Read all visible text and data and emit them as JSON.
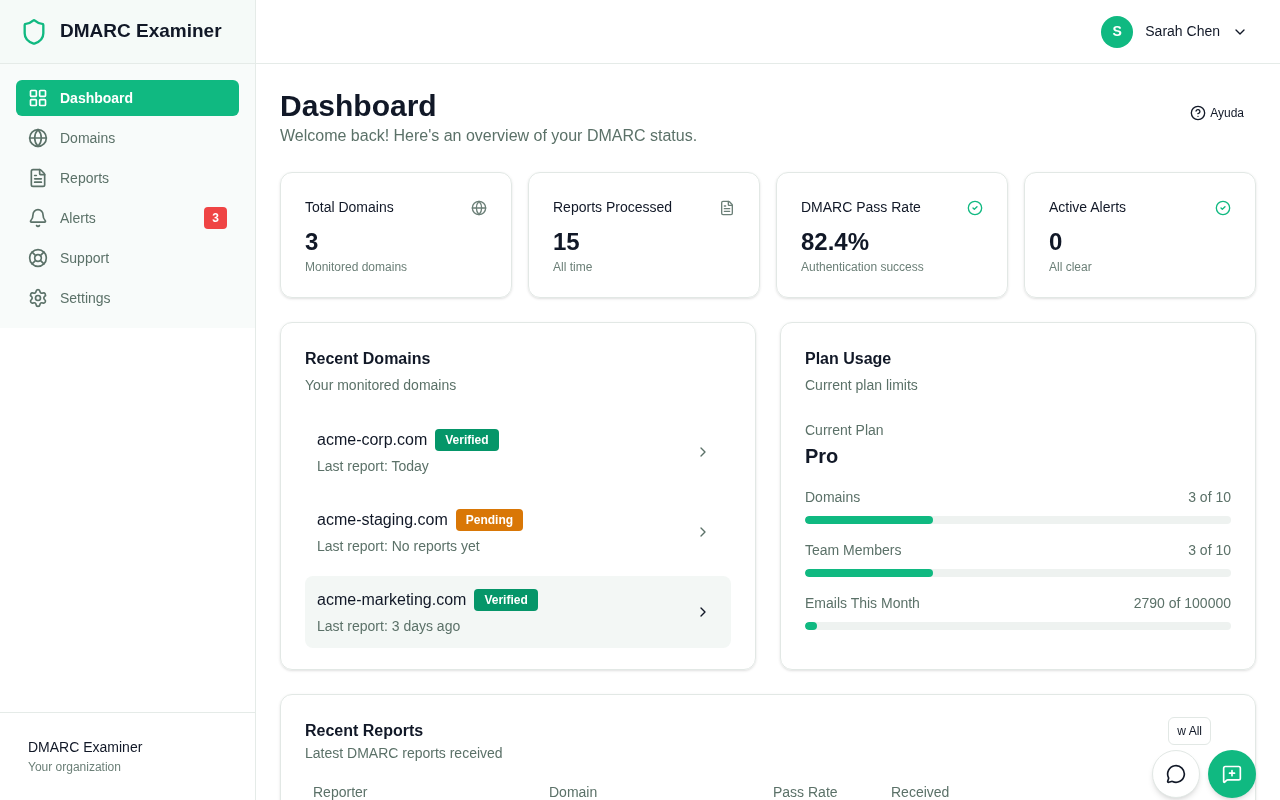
{
  "app": {
    "name": "DMARC Examiner"
  },
  "sidebar": {
    "items": [
      {
        "label": "Dashboard",
        "selected": true
      },
      {
        "label": "Domains",
        "selected": false
      },
      {
        "label": "Reports",
        "selected": false
      },
      {
        "label": "Alerts",
        "selected": false,
        "badge": "3"
      },
      {
        "label": "Support",
        "selected": false
      },
      {
        "label": "Settings",
        "selected": false
      }
    ],
    "footer": {
      "title": "DMARC Examiner",
      "subtitle": "Your organization"
    }
  },
  "user": {
    "initial": "S",
    "name": "Sarah Chen"
  },
  "page": {
    "title": "Dashboard",
    "subtitle": "Welcome back! Here's an overview of your DMARC status.",
    "help": "Ayuda"
  },
  "stats": [
    {
      "title": "Total Domains",
      "value": "3",
      "caption": "Monitored domains"
    },
    {
      "title": "Reports Processed",
      "value": "15",
      "caption": "All time"
    },
    {
      "title": "DMARC Pass Rate",
      "value": "82.4%",
      "caption": "Authentication success"
    },
    {
      "title": "Active Alerts",
      "value": "0",
      "caption": "All clear"
    }
  ],
  "recent_domains": {
    "title": "Recent Domains",
    "subtitle": "Your monitored domains",
    "items": [
      {
        "domain": "acme-corp.com",
        "status": "Verified",
        "kind": "verified",
        "last_report": "Last report: Today",
        "selected": false
      },
      {
        "domain": "acme-staging.com",
        "status": "Pending",
        "kind": "pending",
        "last_report": "Last report: No reports yet",
        "selected": false
      },
      {
        "domain": "acme-marketing.com",
        "status": "Verified",
        "kind": "verified",
        "last_report": "Last report: 3 days ago",
        "selected": true
      }
    ]
  },
  "plan_usage": {
    "title": "Plan Usage",
    "subtitle": "Current plan limits",
    "plan_label": "Current Plan",
    "plan": "Pro",
    "meters": [
      {
        "label": "Domains",
        "reading": "3 of 10",
        "level": 0.3
      },
      {
        "label": "Team Members",
        "reading": "3 of 10",
        "level": 0.3
      },
      {
        "label": "Emails This Month",
        "reading": "2790 of 100000",
        "level": 0.028
      }
    ]
  },
  "recent_reports": {
    "title": "Recent Reports",
    "subtitle": "Latest DMARC reports received",
    "button": "w All",
    "columns": [
      "Reporter",
      "Domain",
      "Pass Rate",
      "Received"
    ]
  }
}
